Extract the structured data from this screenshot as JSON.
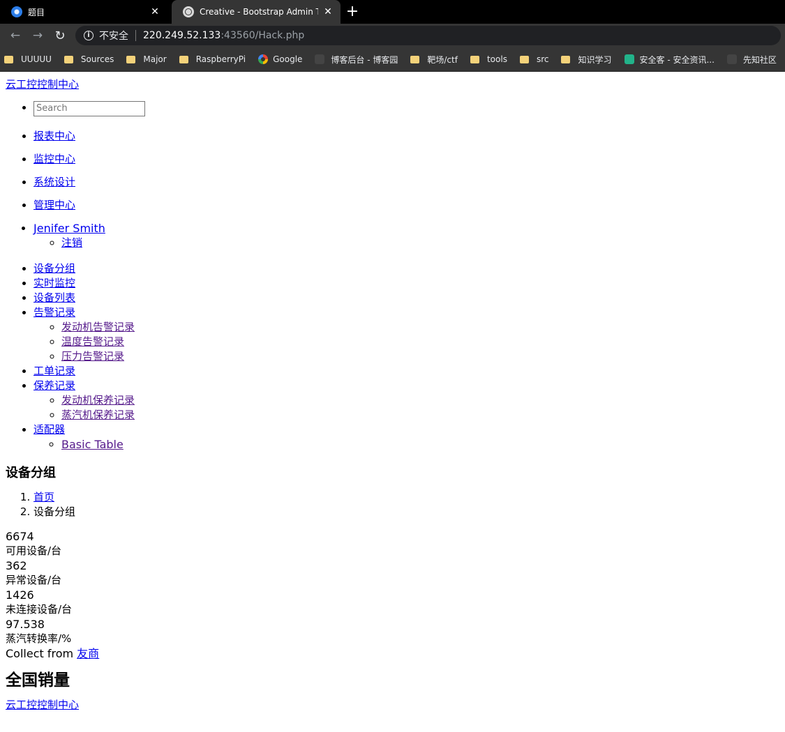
{
  "browser": {
    "tabs": [
      {
        "title": "题目",
        "active": false
      },
      {
        "title": "Creative - Bootstrap Admin Template",
        "active": true
      }
    ],
    "new_tab": "+",
    "close": "✕",
    "security_label": "不安全",
    "url_host": "220.249.52.133",
    "url_rest": ":43560/Hack.php",
    "bookmarks": [
      "UUUUU",
      "Sources",
      "Major",
      "RaspberryPi",
      "Google",
      "博客后台 - 博客园",
      "靶场/ctf",
      "tools",
      "src",
      "知识学习",
      "安全客 - 安全资讯...",
      "先知社区"
    ]
  },
  "header": {
    "brand": "云工控控制中心",
    "search_placeholder": "Search"
  },
  "topnav": {
    "items": [
      "报表中心",
      "监控中心",
      "系统设计",
      "管理中心"
    ],
    "user": " Jenifer Smith",
    "user_menu": [
      "注销"
    ]
  },
  "sidenav": {
    "group": "设备分组",
    "realtime": "实时监控",
    "device_list": "设备列表",
    "alarms": "告警记录",
    "alarm_sub": [
      "发动机告警记录",
      "温度告警记录",
      "压力告警记录"
    ],
    "work_orders": "工单记录",
    "maintenance": "保养记录",
    "maintenance_sub": [
      "发动机保养记录",
      "蒸汽机保养记录"
    ],
    "adapter": "适配器",
    "adapter_sub": [
      "Basic Table"
    ]
  },
  "main": {
    "title": "设备分组",
    "breadcrumb": [
      "首页",
      "设备分组"
    ],
    "stats": [
      {
        "value": "6674",
        "label": "可用设备/台"
      },
      {
        "value": "362",
        "label": "异常设备/台"
      },
      {
        "value": "1426",
        "label": "未连接设备/台"
      },
      {
        "value": "97.538",
        "label": "蒸汽转换率/%"
      }
    ],
    "collect_prefix": "Collect from ",
    "collect_link": "友商",
    "sales_heading": "全国销量"
  },
  "footer": {
    "brand": "云工控控制中心"
  }
}
